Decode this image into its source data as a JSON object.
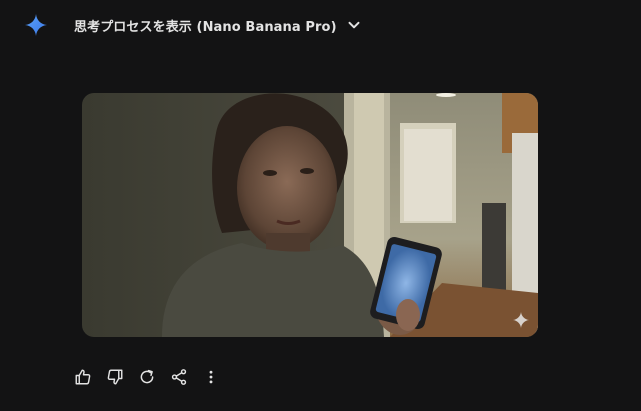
{
  "response": {
    "thinking_toggle_label": "思考プロセスを表示 (Nano Banana Pro)",
    "expand_icon": "chevron-down-icon",
    "assistant_icon": "gemini-sparkle-icon"
  },
  "generated_image": {
    "watermark_icon": "sparkle-icon"
  },
  "actions": [
    {
      "name": "good-response",
      "icon": "thumb-up-icon"
    },
    {
      "name": "bad-response",
      "icon": "thumb-down-icon"
    },
    {
      "name": "regenerate",
      "icon": "refresh-icon"
    },
    {
      "name": "share",
      "icon": "share-icon"
    },
    {
      "name": "more-options",
      "icon": "more-vertical-icon"
    }
  ],
  "colors": {
    "background": "#131314",
    "text": "#e3e3e3",
    "accent_blue": "#4c8df6"
  }
}
